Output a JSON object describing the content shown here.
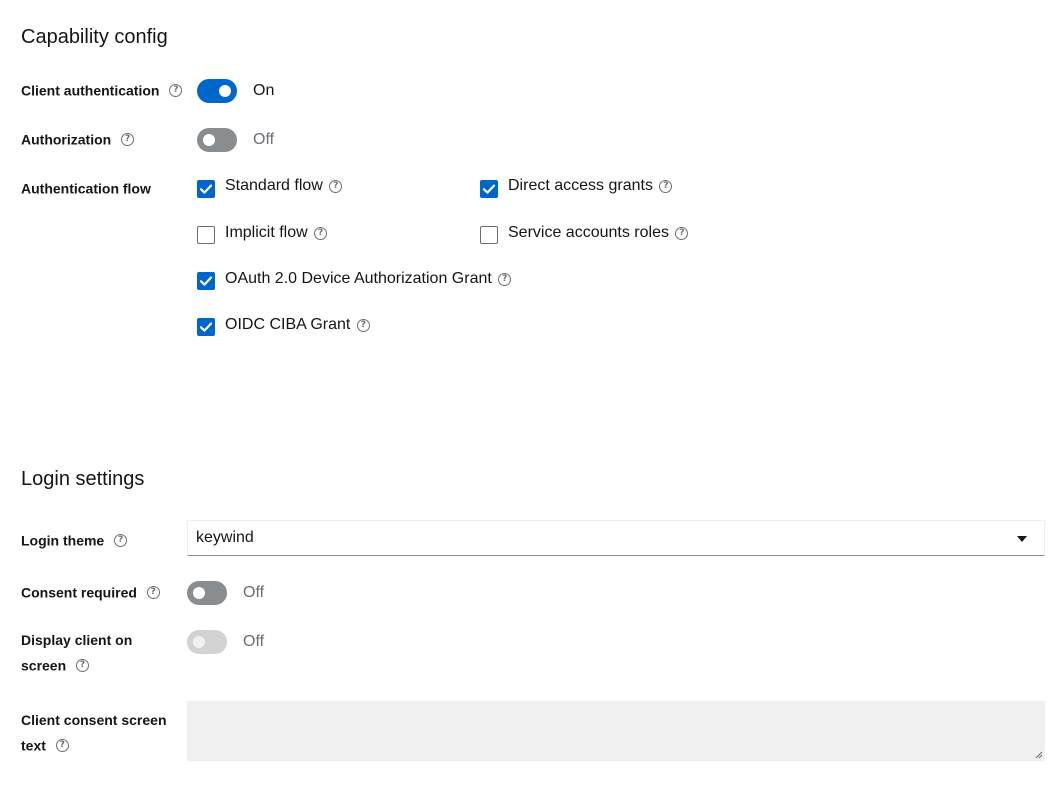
{
  "capability": {
    "title": "Capability config",
    "client_authentication": {
      "label": "Client authentication",
      "state": "On"
    },
    "authorization": {
      "label": "Authorization",
      "state": "Off"
    },
    "authentication_flow": {
      "label": "Authentication flow",
      "options": {
        "standard_flow": {
          "label": "Standard flow",
          "checked": true
        },
        "direct_access_grants": {
          "label": "Direct access grants",
          "checked": true
        },
        "implicit_flow": {
          "label": "Implicit flow",
          "checked": false
        },
        "service_accounts_roles": {
          "label": "Service accounts roles",
          "checked": false
        },
        "oauth_device_grant": {
          "label": "OAuth 2.0 Device Authorization Grant",
          "checked": true
        },
        "oidc_ciba_grant": {
          "label": "OIDC CIBA Grant",
          "checked": true
        }
      }
    }
  },
  "login": {
    "title": "Login settings",
    "login_theme": {
      "label": "Login theme",
      "value": "keywind"
    },
    "consent_required": {
      "label": "Consent required",
      "state": "Off"
    },
    "display_client_on_screen": {
      "label_line1": "Display client on",
      "label_line2": "screen",
      "state": "Off"
    },
    "client_consent_screen_text": {
      "label_line1": "Client consent screen",
      "label_line2": "text",
      "value": ""
    }
  },
  "icons": {
    "help": "help-circle-icon",
    "check": "checkmark-icon",
    "caret": "caret-down-icon"
  },
  "colors": {
    "accent": "#0066cc",
    "switch_off": "#8a8d90",
    "disabled": "#d2d2d2",
    "text": "#151515",
    "muted": "#6a6e73"
  }
}
